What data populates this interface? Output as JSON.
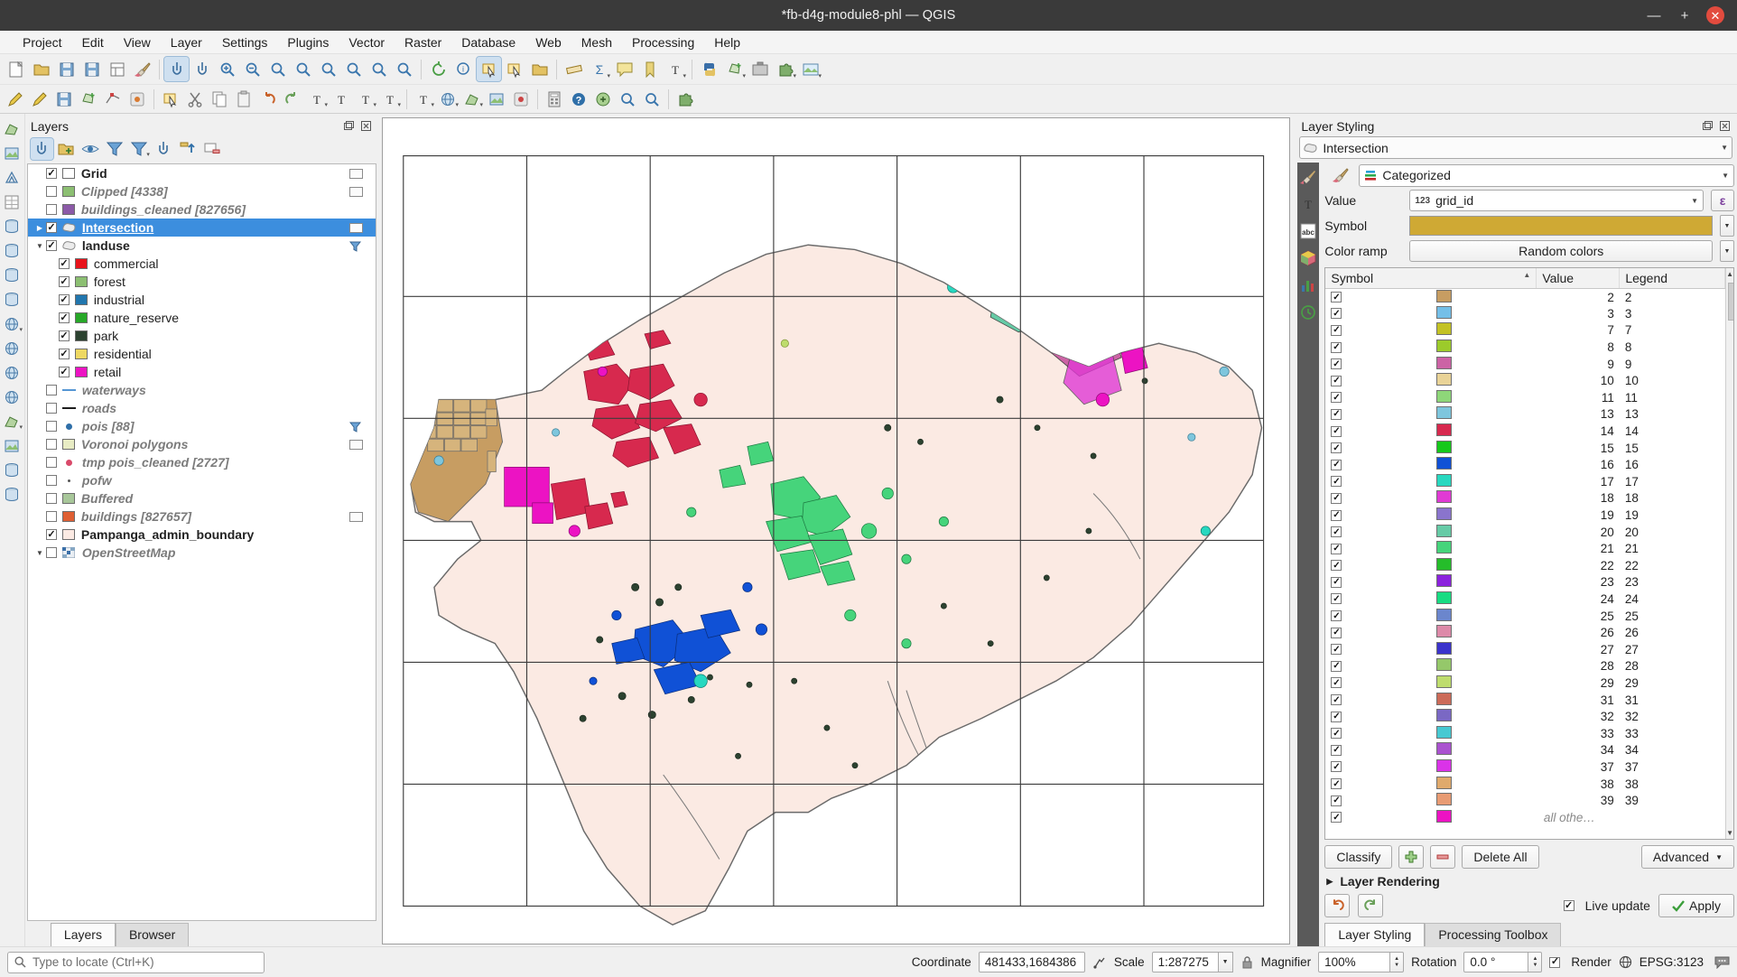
{
  "window": {
    "title": "*fb-d4g-module8-phl — QGIS",
    "minimize_label": "—",
    "maximize_label": "+",
    "close_label": "✕"
  },
  "menubar": {
    "items": [
      "Project",
      "Edit",
      "View",
      "Layer",
      "Settings",
      "Plugins",
      "Vector",
      "Raster",
      "Database",
      "Web",
      "Mesh",
      "Processing",
      "Help"
    ]
  },
  "toolbar_top": {
    "icons": [
      "new-project-icon",
      "open-project-icon",
      "save-project-icon",
      "save-project-as-icon",
      "print-layout-icon",
      "style-manager-icon",
      "pan-map-icon",
      "pan-to-selection-icon",
      "zoom-in-icon",
      "zoom-out-icon",
      "zoom-full-icon",
      "zoom-to-selection-icon",
      "zoom-to-layer-icon",
      "zoom-native-icon",
      "zoom-last-icon",
      "zoom-next-icon",
      "refresh-icon",
      "identify-features-icon",
      "select-features-icon",
      "deselect-features-icon",
      "open-attribute-table-icon",
      "measure-icon",
      "statistical-summary-icon",
      "show-map-tips-icon",
      "new-bookmark-icon",
      "text-annotation-icon",
      "python-console-icon",
      "add-feature-icon",
      "processing-toolbox-icon",
      "plugin-manager-icon",
      "new-map-view-icon"
    ]
  },
  "toolbar_second": {
    "icons": [
      "current-edits-icon",
      "toggle-editing-icon",
      "save-layer-edits-icon",
      "add-polygon-feature-icon",
      "vertex-tool-icon",
      "modify-attributes-icon",
      "delete-selected-icon",
      "cut-features-icon",
      "copy-features-icon",
      "paste-features-icon",
      "undo-icon",
      "redo-icon",
      "label-icon",
      "show-labels-icon",
      "move-label-icon",
      "rotate-label-icon",
      "change-label-icon",
      "add-wms-layer-icon",
      "add-vector-tile-icon",
      "add-point-cloud-icon",
      "run-feature-action-icon",
      "open-field-calculator-icon",
      "help-contents-icon",
      "osm-download-icon",
      "georeferencer-icon",
      "search-qms-icon",
      "plugin-extra-icon"
    ]
  },
  "left_toolbar": {
    "icons": [
      "add-vector-layer-icon",
      "add-raster-layer-icon",
      "add-mesh-layer-icon",
      "add-delimited-text-layer-icon",
      "add-postgis-layer-icon",
      "add-spatialite-layer-icon",
      "add-mssql-layer-icon",
      "add-oracle-layer-icon",
      "add-wms-wmts-layer-icon",
      "add-wcs-layer-icon",
      "add-wfs-layer-icon",
      "add-arcgis-server-layer-icon",
      "add-vector-tile-layer-icon",
      "add-point-cloud-layer-icon",
      "new-virtual-layer-icon",
      "add-gps-layer-icon"
    ]
  },
  "layers_panel": {
    "title": "Layers",
    "float_btn": "float-icon",
    "close_btn": "close-icon",
    "toolbar_icons": [
      "open-layer-styling-panel-icon",
      "add-group-icon",
      "manage-map-themes-icon",
      "filter-legend-icon",
      "filter-legend-by-expression-icon",
      "expand-all-icon",
      "collapse-all-icon",
      "remove-layer-icon"
    ],
    "tabs": [
      {
        "label": "Layers",
        "active": true
      },
      {
        "label": "Browser",
        "active": false
      }
    ],
    "items": [
      {
        "label": "Grid",
        "checked": true,
        "style": "bold",
        "indent": 1,
        "symbol": "poly",
        "color": "#ffffff",
        "arrow": "",
        "badge": "box"
      },
      {
        "label": "Clipped [4338]",
        "checked": false,
        "style": "italic",
        "indent": 1,
        "symbol": "poly",
        "color": "#8cbf72",
        "arrow": "",
        "badge": "box"
      },
      {
        "label": "buildings_cleaned [827656]",
        "checked": false,
        "style": "italic",
        "indent": 1,
        "symbol": "poly",
        "color": "#8c5aa8",
        "arrow": "",
        "badge": ""
      },
      {
        "label": "Intersection",
        "checked": true,
        "style": "sel",
        "indent": 0,
        "symbol": "group",
        "color": "#9a9a9a",
        "arrow": "right",
        "badge": "box"
      },
      {
        "label": "landuse",
        "checked": true,
        "style": "bold",
        "indent": 0,
        "symbol": "group",
        "color": "#9a9a9a",
        "arrow": "down",
        "badge": "filter"
      },
      {
        "label": "commercial",
        "checked": true,
        "style": "plain",
        "indent": 2,
        "symbol": "poly",
        "color": "#e8131b",
        "arrow": "",
        "badge": ""
      },
      {
        "label": "forest",
        "checked": true,
        "style": "plain",
        "indent": 2,
        "symbol": "poly",
        "color": "#8cbf72",
        "arrow": "",
        "badge": ""
      },
      {
        "label": "industrial",
        "checked": true,
        "style": "plain",
        "indent": 2,
        "symbol": "poly",
        "color": "#2176ae",
        "arrow": "",
        "badge": ""
      },
      {
        "label": "nature_reserve",
        "checked": true,
        "style": "plain",
        "indent": 2,
        "symbol": "poly",
        "color": "#27a828",
        "arrow": "",
        "badge": ""
      },
      {
        "label": "park",
        "checked": true,
        "style": "plain",
        "indent": 2,
        "symbol": "poly",
        "color": "#2c4230",
        "arrow": "",
        "badge": ""
      },
      {
        "label": "residential",
        "checked": true,
        "style": "plain",
        "indent": 2,
        "symbol": "poly",
        "color": "#eed862",
        "arrow": "",
        "badge": ""
      },
      {
        "label": "retail",
        "checked": true,
        "style": "plain",
        "indent": 2,
        "symbol": "poly",
        "color": "#ec13c3",
        "arrow": "",
        "badge": ""
      },
      {
        "label": "waterways",
        "checked": false,
        "style": "italic",
        "indent": 1,
        "symbol": "line",
        "color": "#5596d4",
        "arrow": "",
        "badge": ""
      },
      {
        "label": "roads",
        "checked": false,
        "style": "italic",
        "indent": 1,
        "symbol": "line",
        "color": "#1d1d1d",
        "arrow": "",
        "badge": ""
      },
      {
        "label": "pois [88]",
        "checked": false,
        "style": "italic",
        "indent": 1,
        "symbol": "point",
        "color": "#2f6fa8",
        "arrow": "",
        "badge": "filter"
      },
      {
        "label": "Voronoi polygons",
        "checked": false,
        "style": "italic",
        "indent": 1,
        "symbol": "poly",
        "color": "#e8ecc4",
        "arrow": "",
        "badge": "box"
      },
      {
        "label": "tmp pois_cleaned [2727]",
        "checked": false,
        "style": "italic",
        "indent": 1,
        "symbol": "point",
        "color": "#d94a6a",
        "arrow": "",
        "badge": ""
      },
      {
        "label": "pofw",
        "checked": false,
        "style": "italic",
        "indent": 1,
        "symbol": "dot",
        "color": "#555555",
        "arrow": "",
        "badge": ""
      },
      {
        "label": "Buffered",
        "checked": false,
        "style": "italic",
        "indent": 1,
        "symbol": "poly",
        "color": "#a8c79a",
        "arrow": "",
        "badge": ""
      },
      {
        "label": "buildings [827657]",
        "checked": false,
        "style": "italic",
        "indent": 1,
        "symbol": "poly",
        "color": "#df5f33",
        "arrow": "",
        "badge": "box"
      },
      {
        "label": "Pampanga_admin_boundary",
        "checked": true,
        "style": "bold",
        "indent": 1,
        "symbol": "poly",
        "color": "#fbeae3",
        "arrow": "",
        "badge": ""
      },
      {
        "label": "OpenStreetMap",
        "checked": false,
        "style": "italic",
        "indent": 0,
        "symbol": "raster",
        "color": "#3a6fa8",
        "arrow": "down",
        "badge": ""
      }
    ]
  },
  "layer_styling": {
    "title": "Layer Styling",
    "float_btn": "float-icon",
    "close_btn": "close-icon",
    "layer_selector": "Intersection",
    "renderer": "Categorized",
    "side_icons": [
      "symbology-icon",
      "labels-icon",
      "masks-icon",
      "3d-view-icon",
      "diagrams-icon",
      "history-icon"
    ],
    "fields": {
      "value_label": "Value",
      "value": "grid_id",
      "value_type_badge": "123",
      "expression_btn": "ε",
      "symbol_label": "Symbol",
      "symbol_color": "#cfa934",
      "colorramp_label": "Color ramp",
      "colorramp": "Random colors"
    },
    "table": {
      "columns": [
        "Symbol",
        "Value",
        "Legend"
      ],
      "sort_indicator": "▲",
      "rows": [
        {
          "checked": true,
          "color": "#c79d62",
          "value": "2",
          "legend": "2"
        },
        {
          "checked": true,
          "color": "#74bfe8",
          "value": "3",
          "legend": "3"
        },
        {
          "checked": true,
          "color": "#c3c224",
          "value": "7",
          "legend": "7"
        },
        {
          "checked": true,
          "color": "#9ccb2b",
          "value": "8",
          "legend": "8"
        },
        {
          "checked": true,
          "color": "#cc63a5",
          "value": "9",
          "legend": "9"
        },
        {
          "checked": true,
          "color": "#e9d397",
          "value": "10",
          "legend": "10"
        },
        {
          "checked": true,
          "color": "#8ed779",
          "value": "11",
          "legend": "11"
        },
        {
          "checked": true,
          "color": "#7ec6dd",
          "value": "13",
          "legend": "13"
        },
        {
          "checked": true,
          "color": "#d7294e",
          "value": "14",
          "legend": "14"
        },
        {
          "checked": true,
          "color": "#16c81b",
          "value": "15",
          "legend": "15"
        },
        {
          "checked": true,
          "color": "#1051d6",
          "value": "16",
          "legend": "16"
        },
        {
          "checked": true,
          "color": "#27d8c0",
          "value": "17",
          "legend": "17"
        },
        {
          "checked": true,
          "color": "#e03ad4",
          "value": "18",
          "legend": "18"
        },
        {
          "checked": true,
          "color": "#8a74cd",
          "value": "19",
          "legend": "19"
        },
        {
          "checked": true,
          "color": "#66cba6",
          "value": "20",
          "legend": "20"
        },
        {
          "checked": true,
          "color": "#46d47b",
          "value": "21",
          "legend": "21"
        },
        {
          "checked": true,
          "color": "#25bd2a",
          "value": "22",
          "legend": "22"
        },
        {
          "checked": true,
          "color": "#8b22dd",
          "value": "23",
          "legend": "23"
        },
        {
          "checked": true,
          "color": "#18dc82",
          "value": "24",
          "legend": "24"
        },
        {
          "checked": true,
          "color": "#6b86cd",
          "value": "25",
          "legend": "25"
        },
        {
          "checked": true,
          "color": "#dd8aa9",
          "value": "26",
          "legend": "26"
        },
        {
          "checked": true,
          "color": "#3b33cc",
          "value": "27",
          "legend": "27"
        },
        {
          "checked": true,
          "color": "#95c86a",
          "value": "28",
          "legend": "28"
        },
        {
          "checked": true,
          "color": "#bedc6d",
          "value": "29",
          "legend": "29"
        },
        {
          "checked": true,
          "color": "#cc6b58",
          "value": "31",
          "legend": "31"
        },
        {
          "checked": true,
          "color": "#7a68c4",
          "value": "32",
          "legend": "32"
        },
        {
          "checked": true,
          "color": "#47c9d2",
          "value": "33",
          "legend": "33"
        },
        {
          "checked": true,
          "color": "#aa52cf",
          "value": "34",
          "legend": "34"
        },
        {
          "checked": true,
          "color": "#da33e8",
          "value": "37",
          "legend": "37"
        },
        {
          "checked": true,
          "color": "#e0aa6c",
          "value": "38",
          "legend": "38"
        },
        {
          "checked": true,
          "color": "#e89b73",
          "value": "39",
          "legend": "39"
        },
        {
          "checked": true,
          "color": "#ec13c3",
          "value": "all othe…",
          "legend": ""
        }
      ]
    },
    "buttons": {
      "classify": "Classify",
      "add": "add-class-icon",
      "remove": "remove-class-icon",
      "delete_all": "Delete All",
      "advanced": "Advanced"
    },
    "layer_rendering": "Layer Rendering",
    "undo_icon": "undo-icon",
    "redo_icon": "redo-icon",
    "live_update_label": "Live update",
    "live_update_checked": true,
    "apply": "Apply",
    "tabs": [
      {
        "label": "Layer Styling",
        "active": true
      },
      {
        "label": "Processing Toolbox",
        "active": false
      }
    ]
  },
  "statusbar": {
    "locator_placeholder": "Type to locate (Ctrl+K)",
    "coordinate_label": "Coordinate",
    "coordinate_value": "481433,1684386",
    "scale_label": "Scale",
    "scale_value": "1:287275",
    "lock_icon": "lock-icon",
    "magnifier_label": "Magnifier",
    "magnifier_value": "100%",
    "rotation_label": "Rotation",
    "rotation_value": "0.0 °",
    "render_label": "Render",
    "render_checked": true,
    "crs_value": "EPSG:3123",
    "messages_icon": "messages-icon"
  },
  "map": {
    "background": "#ffffff",
    "admin_fill": "#fbeae3",
    "admin_stroke": "#6a6a6a",
    "grid_stroke": "#3c3c3c"
  }
}
